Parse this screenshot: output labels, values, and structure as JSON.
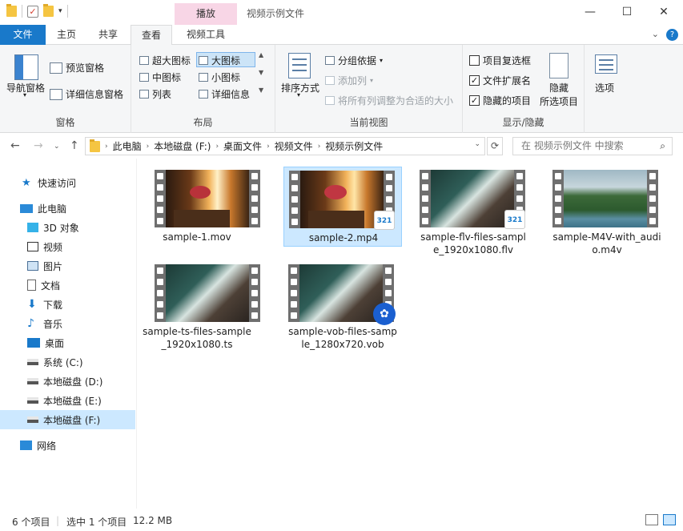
{
  "titlebar": {
    "context_tab": "播放",
    "title": "视频示例文件",
    "buttons": [
      "—",
      "☐",
      "✕"
    ]
  },
  "tabs": {
    "file": "文件",
    "home": "主页",
    "share": "共享",
    "view": "查看",
    "video_tools": "视频工具"
  },
  "ribbon": {
    "panes": {
      "nav_pane": "导航窗格",
      "preview_pane": "预览窗格",
      "details_pane": "详细信息窗格",
      "label": "窗格"
    },
    "layout": {
      "extra_large": "超大图标",
      "large": "大图标",
      "medium": "中图标",
      "small": "小图标",
      "list": "列表",
      "details": "详细信息",
      "label": "布局"
    },
    "current_view": {
      "sort_by": "排序方式",
      "group_by": "分组依据",
      "add_columns": "添加列",
      "size_columns": "将所有列调整为合适的大小",
      "label": "当前视图"
    },
    "show_hide": {
      "item_checkboxes": "项目复选框",
      "file_extensions": "文件扩展名",
      "hidden_items": "隐藏的项目",
      "hide_selected_1": "隐藏",
      "hide_selected_2": "所选项目",
      "label": "显示/隐藏",
      "item_checkboxes_checked": false,
      "file_extensions_checked": true,
      "hidden_items_checked": true
    },
    "options": "选项"
  },
  "address": {
    "crumbs": [
      "此电脑",
      "本地磁盘 (F:)",
      "桌面文件",
      "视频文件",
      "视频示例文件"
    ],
    "search_placeholder": "在 视频示例文件 中搜索"
  },
  "nav": {
    "quick_access": "快速访问",
    "this_pc": "此电脑",
    "objects3d": "3D 对象",
    "videos": "视频",
    "pictures": "图片",
    "documents": "文档",
    "downloads": "下载",
    "music": "音乐",
    "desktop": "桌面",
    "drive_c": "系统 (C:)",
    "drive_d": "本地磁盘 (D:)",
    "drive_e": "本地磁盘 (E:)",
    "drive_f": "本地磁盘 (F:)",
    "network": "网络"
  },
  "files": [
    {
      "line1": "sample-1.mov",
      "line2": ""
    },
    {
      "line1": "sample-2.mp4",
      "line2": ""
    },
    {
      "line1": "sample-flv-files-sampl",
      "line2": "e_1920x1080.flv"
    },
    {
      "line1": "sample-M4V-with_audi",
      "line2": "o.m4v"
    },
    {
      "line1": "sample-ts-files-sample",
      "line2": "_1920x1080.ts"
    },
    {
      "line1": "sample-vob-files-samp",
      "line2": "le_1280x720.vob"
    }
  ],
  "badge_text": "321",
  "status": {
    "count": "6 个项目",
    "selected": "选中 1 个项目",
    "size": "12.2 MB"
  }
}
